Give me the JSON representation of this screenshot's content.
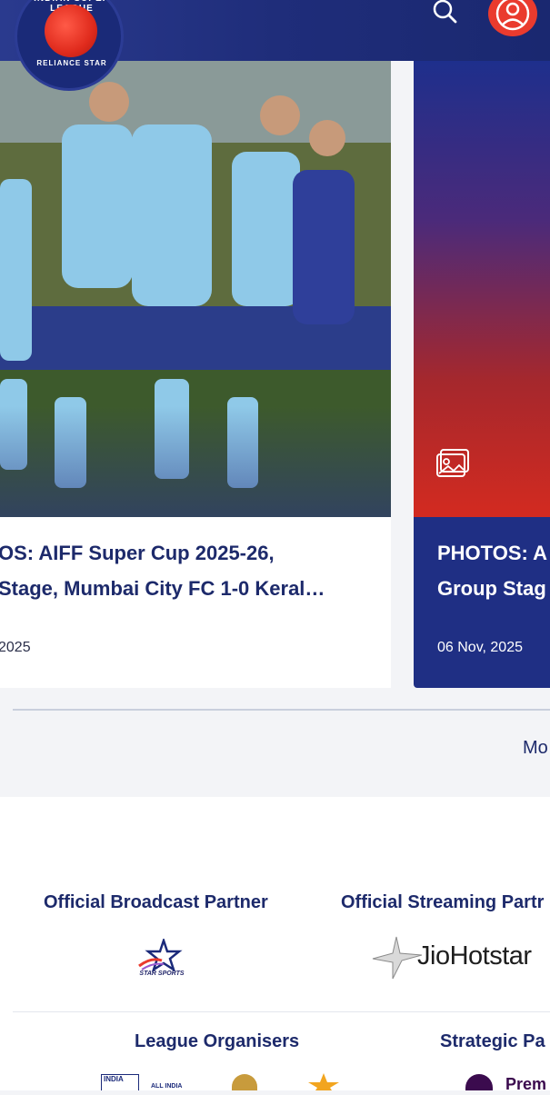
{
  "header": {
    "logo_text_top": "INDIAN SUPER LEAGUE",
    "logo_text_bottom": "RELIANCE STAR",
    "search_icon": "search-icon",
    "profile_icon": "user-profile-icon",
    "colors": {
      "header_bg": "#1f2d7a",
      "accent": "#ea3b2e"
    }
  },
  "cards": [
    {
      "title_line1": "OS: AIFF Super Cup 2025-26,",
      "title_line2": " Stage, Mumbai City FC 1-0 Keral…",
      "date": "2025"
    },
    {
      "title_line1": "PHOTOS: A",
      "title_line2": "Group Stag",
      "date": "06 Nov, 2025",
      "icon": "gallery-icon"
    }
  ],
  "more_link": "Mo",
  "partners": {
    "broadcast_heading": "Official Broadcast Partner",
    "broadcast_logo_text": "STAR SPORTS",
    "streaming_heading": "Official Streaming Partr",
    "streaming_logo_text": "JioHotstar",
    "organisers_heading": "League Organisers",
    "strategic_heading": "Strategic Pa",
    "organiser_logo_text": "INDIA",
    "organiser_logo_text2": "ALL INDIA",
    "strategic_logo_text": "Prem"
  }
}
